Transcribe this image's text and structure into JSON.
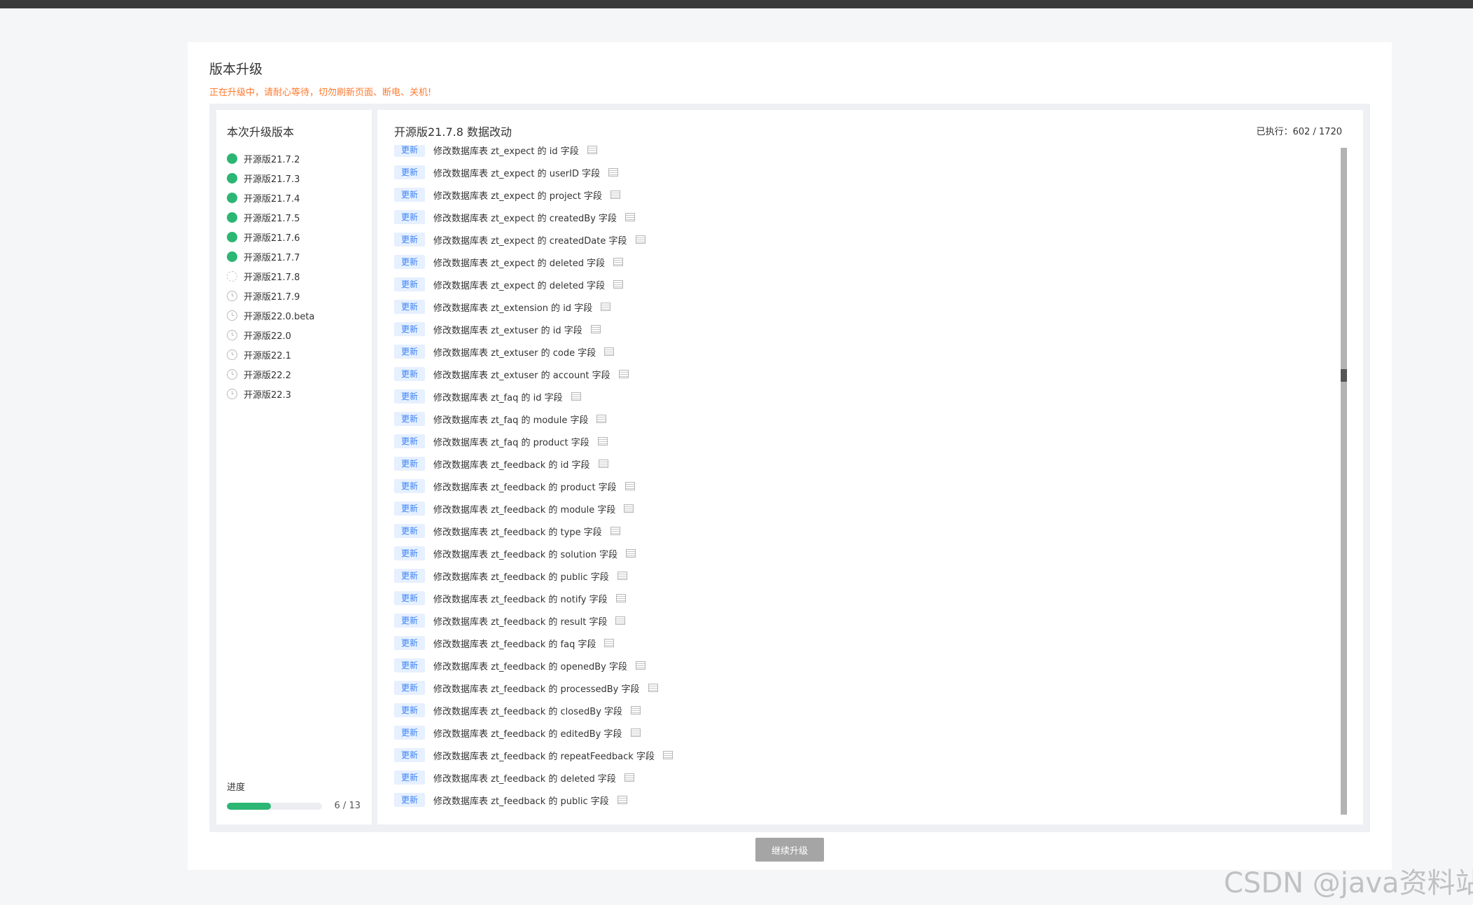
{
  "page": {
    "title": "版本升级",
    "warning": "正在升级中，请耐心等待，切勿刷新页面、断电、关机!"
  },
  "versions": {
    "title": "本次升级版本",
    "items": [
      {
        "label": "开源版21.7.2",
        "status": "done"
      },
      {
        "label": "开源版21.7.3",
        "status": "done"
      },
      {
        "label": "开源版21.7.4",
        "status": "done"
      },
      {
        "label": "开源版21.7.5",
        "status": "done"
      },
      {
        "label": "开源版21.7.6",
        "status": "done"
      },
      {
        "label": "开源版21.7.7",
        "status": "done"
      },
      {
        "label": "开源版21.7.8",
        "status": "running"
      },
      {
        "label": "开源版21.7.9",
        "status": "waiting"
      },
      {
        "label": "开源版22.0.beta",
        "status": "waiting"
      },
      {
        "label": "开源版22.0",
        "status": "waiting"
      },
      {
        "label": "开源版22.1",
        "status": "waiting"
      },
      {
        "label": "开源版22.2",
        "status": "waiting"
      },
      {
        "label": "开源版22.3",
        "status": "waiting"
      }
    ],
    "progress": {
      "label": "进度",
      "count": "6 / 13",
      "fraction": 0.4615
    }
  },
  "changes": {
    "title": "开源版21.7.8 数据改动",
    "executed": "已执行：602 / 1720",
    "tag_label": "更新",
    "rows": [
      "修改数据库表 zt_expect 的 id 字段",
      "修改数据库表 zt_expect 的 userID 字段",
      "修改数据库表 zt_expect 的 project 字段",
      "修改数据库表 zt_expect 的 createdBy 字段",
      "修改数据库表 zt_expect 的 createdDate 字段",
      "修改数据库表 zt_expect 的 deleted 字段",
      "修改数据库表 zt_expect 的 deleted 字段",
      "修改数据库表 zt_extension 的 id 字段",
      "修改数据库表 zt_extuser 的 id 字段",
      "修改数据库表 zt_extuser 的 code 字段",
      "修改数据库表 zt_extuser 的 account 字段",
      "修改数据库表 zt_faq 的 id 字段",
      "修改数据库表 zt_faq 的 module 字段",
      "修改数据库表 zt_faq 的 product 字段",
      "修改数据库表 zt_feedback 的 id 字段",
      "修改数据库表 zt_feedback 的 product 字段",
      "修改数据库表 zt_feedback 的 module 字段",
      "修改数据库表 zt_feedback 的 type 字段",
      "修改数据库表 zt_feedback 的 solution 字段",
      "修改数据库表 zt_feedback 的 public 字段",
      "修改数据库表 zt_feedback 的 notify 字段",
      "修改数据库表 zt_feedback 的 result 字段",
      "修改数据库表 zt_feedback 的 faq 字段",
      "修改数据库表 zt_feedback 的 openedBy 字段",
      "修改数据库表 zt_feedback 的 processedBy 字段",
      "修改数据库表 zt_feedback 的 closedBy 字段",
      "修改数据库表 zt_feedback 的 editedBy 字段",
      "修改数据库表 zt_feedback 的 repeatFeedback 字段",
      "修改数据库表 zt_feedback 的 deleted 字段",
      "修改数据库表 zt_feedback 的 public 字段"
    ]
  },
  "actions": {
    "continue_label": "继续升级"
  },
  "watermark": "CSDN @java资料站",
  "colors": {
    "done": "#2bb673",
    "warning": "#ff7a2f",
    "tag_bg": "#e6f0ff",
    "tag_text": "#3b82f6",
    "button": "#a5a5a5"
  }
}
